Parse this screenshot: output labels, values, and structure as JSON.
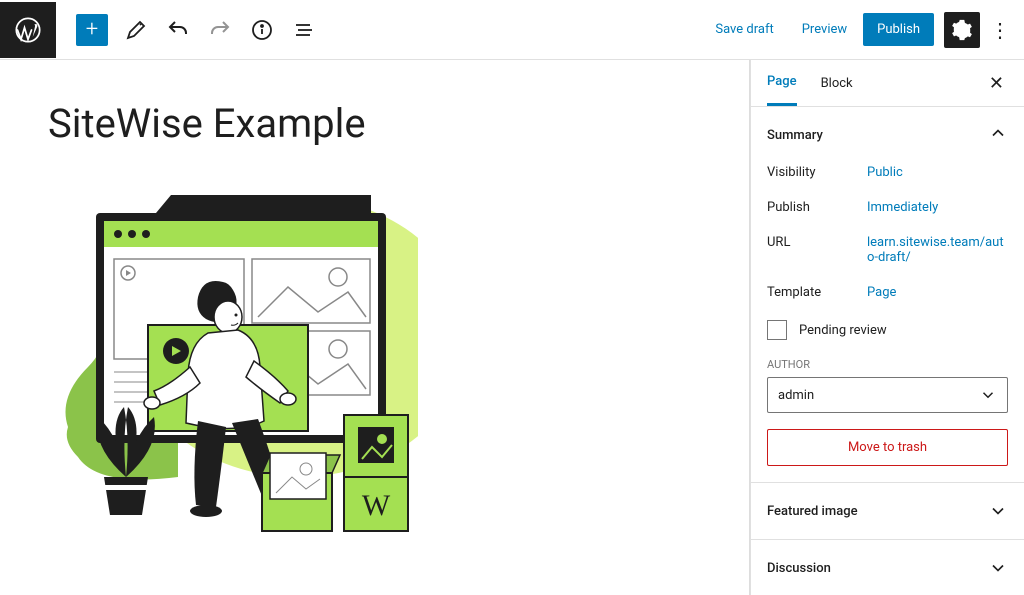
{
  "topbar": {
    "save_draft": "Save draft",
    "preview": "Preview",
    "publish": "Publish"
  },
  "editor": {
    "title": "SiteWise Example"
  },
  "sidebar": {
    "tabs": {
      "page": "Page",
      "block": "Block"
    },
    "summary": {
      "heading": "Summary",
      "visibility_label": "Visibility",
      "visibility_value": "Public",
      "publish_label": "Publish",
      "publish_value": "Immediately",
      "url_label": "URL",
      "url_value": "learn.sitewise.team/auto-draft/",
      "template_label": "Template",
      "template_value": "Page",
      "pending_review": "Pending review",
      "author_label": "AUTHOR",
      "author_value": "admin",
      "move_to_trash": "Move to trash"
    },
    "featured_image": "Featured image",
    "discussion": "Discussion"
  }
}
